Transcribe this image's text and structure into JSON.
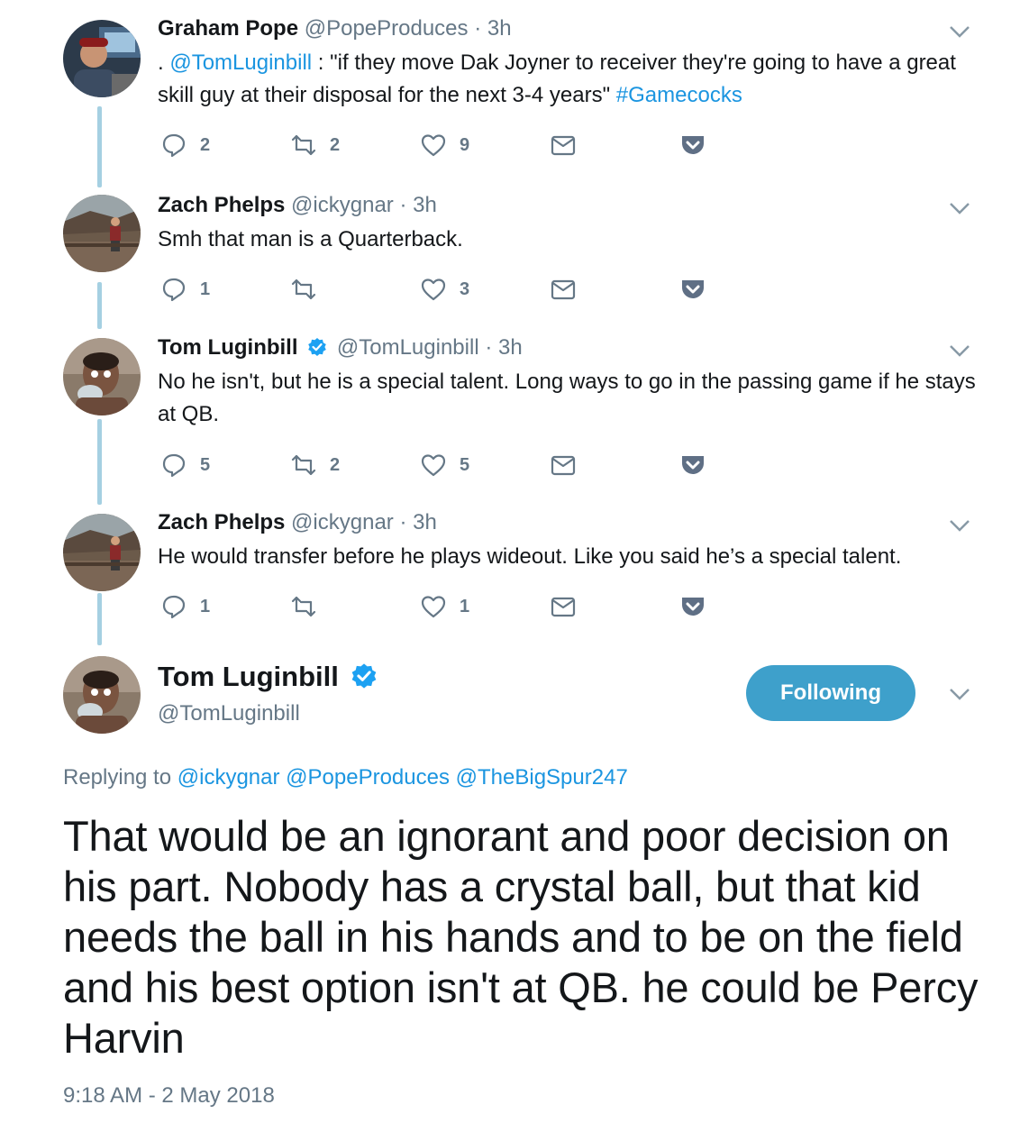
{
  "accent_color": "#1b95e0",
  "thread_line_color": "#a5d0e2",
  "tweets": [
    {
      "name": "Graham Pope",
      "handle": "@PopeProduces",
      "time": "3h",
      "verified": false,
      "text_parts": [
        ". ",
        "@TomLuginbill",
        " : \"if they move Dak Joyner to receiver they're going to have a great skill guy at their disposal for the next 3-4 years\" ",
        "#Gamecocks"
      ],
      "reply_count": "2",
      "retweet_count": "2",
      "like_count": "9"
    },
    {
      "name": "Zach Phelps",
      "handle": "@ickygnar",
      "time": "3h",
      "verified": false,
      "text": "Smh that man is a Quarterback.",
      "reply_count": "1",
      "retweet_count": "",
      "like_count": "3"
    },
    {
      "name": "Tom Luginbill",
      "handle": "@TomLuginbill",
      "time": "3h",
      "verified": true,
      "text": "No he isn't, but he is a special talent. Long ways to go in the passing game if he stays at QB.",
      "reply_count": "5",
      "retweet_count": "2",
      "like_count": "5"
    },
    {
      "name": "Zach Phelps",
      "handle": "@ickygnar",
      "time": "3h",
      "verified": false,
      "text": "He would transfer before he plays wideout. Like you said he’s a special talent.",
      "reply_count": "1",
      "retweet_count": "",
      "like_count": "1"
    }
  ],
  "dot": "·",
  "main_tweet": {
    "name": "Tom Luginbill",
    "handle": "@TomLuginbill",
    "follow_label": "Following",
    "replying_prefix": "Replying to",
    "replying_to": [
      "@ickygnar",
      "@PopeProduces",
      "@TheBigSpur247"
    ],
    "text": "That would be an ignorant and poor decision on his part. Nobody has a crystal ball, but that kid needs the ball in his hands and to be on the field and his best option isn't at QB. he could be Percy Harvin",
    "timestamp": "9:18 AM - 2 May 2018"
  }
}
